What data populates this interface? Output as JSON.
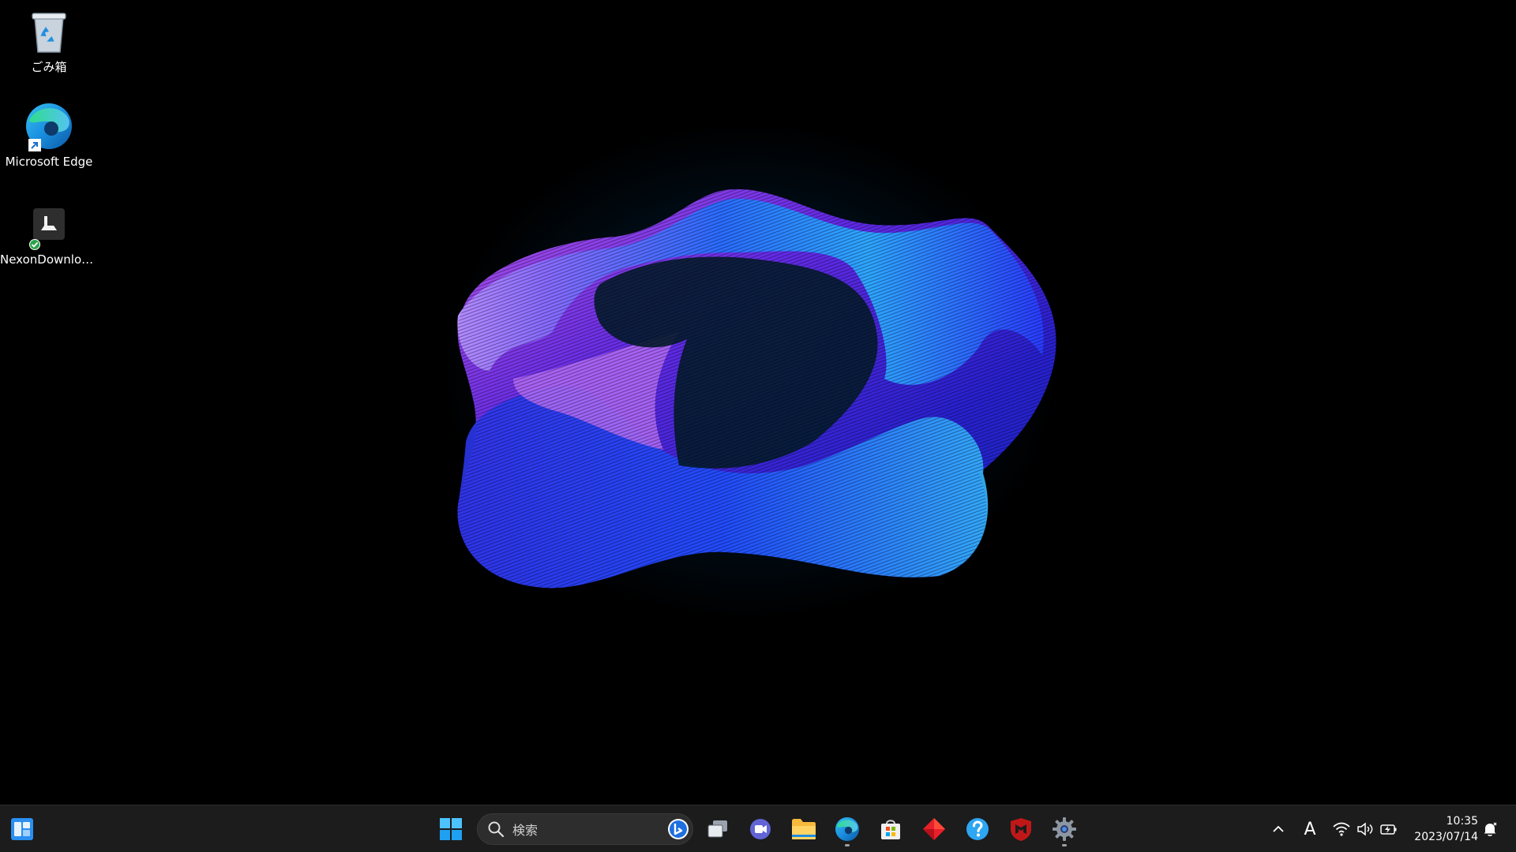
{
  "desktop": {
    "icons": [
      {
        "label": "ごみ箱",
        "icon": "recycle-bin-icon"
      },
      {
        "label": "Microsoft Edge",
        "icon": "edge-icon"
      },
      {
        "label": "NexonDownloa...",
        "icon": "nexon-downloader-icon"
      }
    ]
  },
  "taskbar": {
    "widgets": {
      "icon": "widgets-icon"
    },
    "start": {
      "icon": "windows-start-icon"
    },
    "search": {
      "placeholder": "検索",
      "icon": "search-icon",
      "bing_icon": "bing-icon"
    },
    "pinned_apps": [
      {
        "name": "Task View",
        "icon": "task-view-icon",
        "running": false
      },
      {
        "name": "Teams Chat",
        "icon": "teams-chat-icon",
        "running": false
      },
      {
        "name": "File Explorer",
        "icon": "file-explorer-icon",
        "running": false
      },
      {
        "name": "Microsoft Edge",
        "icon": "edge-icon",
        "running": true
      },
      {
        "name": "Microsoft Store",
        "icon": "store-icon",
        "running": false
      },
      {
        "name": "Red App",
        "icon": "red-diamond-icon",
        "running": false
      },
      {
        "name": "Get Help",
        "icon": "help-icon",
        "running": false
      },
      {
        "name": "McAfee",
        "icon": "mcafee-icon",
        "running": false
      },
      {
        "name": "Settings",
        "icon": "settings-gear-icon",
        "running": true
      }
    ],
    "tray": {
      "overflow_icon": "chevron-up-icon",
      "ime_label": "A",
      "wifi_icon": "wifi-icon",
      "volume_icon": "volume-icon",
      "battery_icon": "battery-charging-icon",
      "notification_icon": "notification-bell-icon"
    },
    "clock": {
      "time": "10:35",
      "date": "2023/07/14"
    }
  },
  "colors": {
    "taskbar_bg": "#1c1c1c",
    "accent": "#0078d4",
    "wallpaper_blue": "#2a2ad8",
    "wallpaper_violet": "#9b3cf0",
    "wallpaper_cyan": "#33c6ff"
  }
}
